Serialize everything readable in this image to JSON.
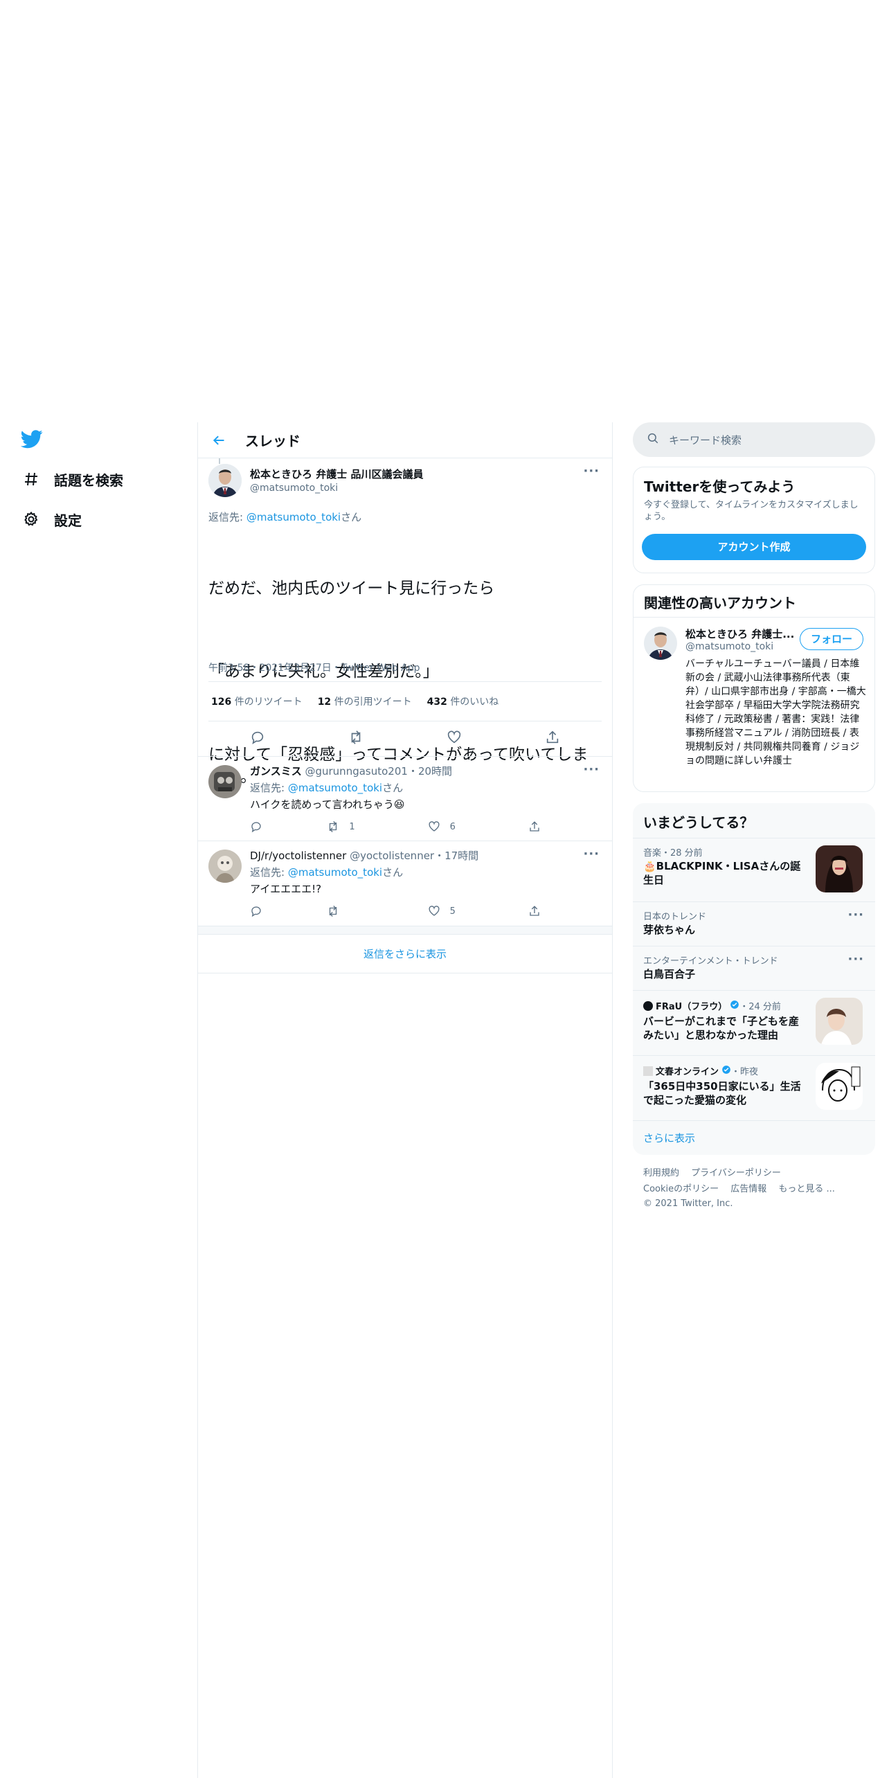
{
  "nav": {
    "logo_icon": "twitter-bird-icon",
    "items": [
      {
        "label": "話題を検索",
        "icon": "hashtag-icon"
      },
      {
        "label": "設定",
        "icon": "gear-icon"
      }
    ]
  },
  "header": {
    "title": "スレッド"
  },
  "tweet": {
    "name": "松本ときひろ 弁護士 品川区議会議員",
    "handle": "@matsumoto_toki",
    "reply_prefix": "返信先: ",
    "reply_to": "@matsumoto_toki",
    "reply_suffix": "さん",
    "text_line1": "だめだ、池内氏のツイート見に行ったら",
    "text_line2": "「あまりに失礼。女性差別だ。」",
    "text_line3": "に対して「忍殺感」ってコメントがあって吹いてしまった。",
    "timestamp": "午前3:58・2021年3月27日・Twitter Web App",
    "retweets": "126",
    "retweets_label": "件のリツイート",
    "quotes": "12",
    "quotes_label": "件の引用ツイート",
    "likes": "432",
    "likes_label": "件のいいね"
  },
  "replies": [
    {
      "name": "ガンスミス",
      "handle": "@gurunngasuto201",
      "time": "・20時間",
      "reply_prefix": "返信先: ",
      "reply_to": "@matsumoto_toki",
      "reply_suffix": "さん",
      "text": "ハイクを読めって言われちゃう😆",
      "retweets": "1",
      "likes": "6"
    },
    {
      "name": "DJ/r/yoctolistenner",
      "handle": "@yoctolistenner",
      "time": "・17時間",
      "reply_prefix": "返信先: ",
      "reply_to": "@matsumoto_toki",
      "reply_suffix": "さん",
      "text": "アイエエエエ!?",
      "retweets": "",
      "likes": "5"
    }
  ],
  "show_more_replies": "返信をさらに表示",
  "search": {
    "placeholder": "キーワード検索"
  },
  "signup": {
    "title": "Twitterを使ってみよう",
    "desc": "今すぐ登録して、タイムラインをカスタマイズしましょう。",
    "button": "アカウント作成"
  },
  "related": {
    "title": "関連性の高いアカウント",
    "name": "松本ときひろ 弁護士...",
    "handle": "@matsumoto_toki",
    "follow": "フォロー",
    "bio": "バーチャルユーチューバー議員 / 日本維新の会 / 武蔵小山法律事務所代表（東弁）/ 山口県宇部市出身 / 宇部高・一橋大社会学部卒 / 早稲田大学大学院法務研究科修了 / 元政策秘書 / 著書：実践！法律事務所経営マニュアル / 消防団班長 / 表現規制反対 / 共同親権共同養育 / ジョジョの問題に詳しい弁護士"
  },
  "trends": {
    "title": "いまどうしてる？",
    "items": [
      {
        "meta": "音楽・28 分前",
        "title": "🎂BLACKPINK・LISAさんの誕生日",
        "has_thumb": true
      },
      {
        "meta": "日本のトレンド",
        "title": "芽依ちゃん",
        "has_thumb": false
      },
      {
        "meta": "エンターテインメント・トレンド",
        "title": "白鳥百合子",
        "has_thumb": false
      },
      {
        "meta_source": "FRaU（フラウ）",
        "meta_time": "・24 分前",
        "title": "バービーがこれまで「子どもを産みたい」と思わなかった理由",
        "has_thumb": true
      },
      {
        "meta_source": "文春オンライン",
        "meta_time": "・昨夜",
        "title": "「365日中350日家にいる」生活で起こった愛猫の変化",
        "has_thumb": true
      }
    ],
    "show_more": "さらに表示"
  },
  "footer": {
    "links": [
      "利用規約",
      "プライバシーポリシー",
      "Cookieのポリシー",
      "広告情報",
      "もっと見る ..."
    ],
    "copyright": "© 2021 Twitter, Inc."
  },
  "colors": {
    "accent": "#1da1f2",
    "link": "#1b95e0",
    "text": "#0f1419",
    "muted": "#5b7083",
    "border": "#e6ecf0"
  }
}
